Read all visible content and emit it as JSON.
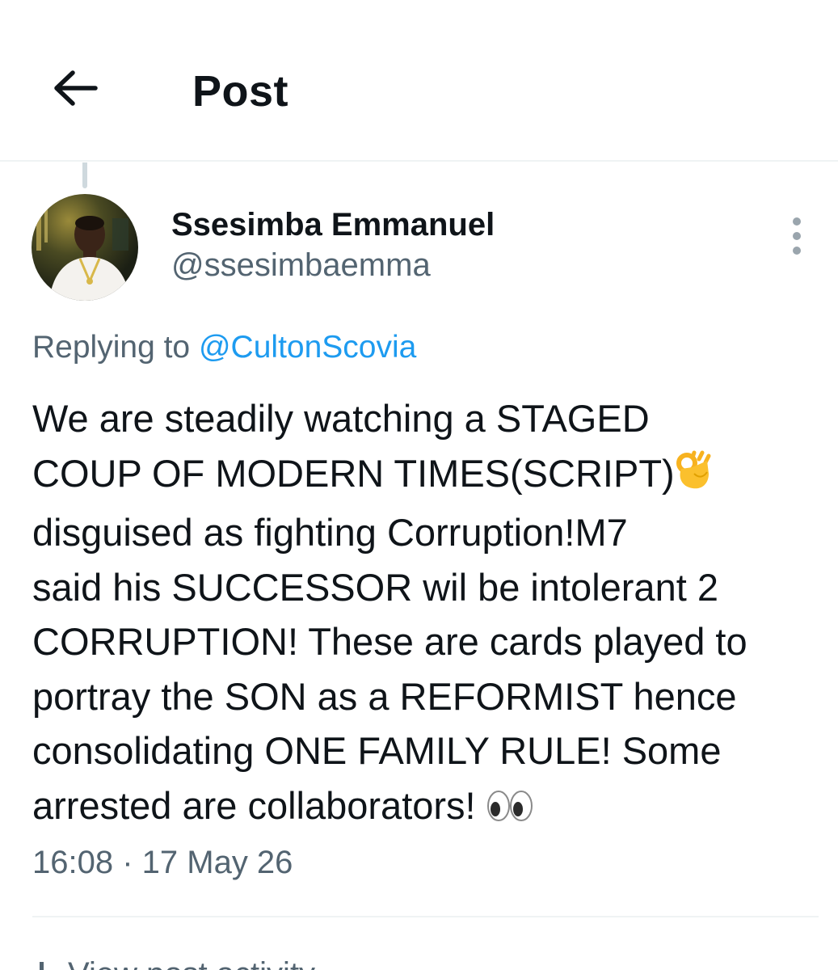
{
  "header": {
    "title": "Post",
    "back_icon": "arrow-left-icon"
  },
  "author": {
    "display_name": "Ssesimba Emmanuel",
    "handle": "@ssesimbaemma",
    "more_icon": "more-vertical-icon"
  },
  "reply": {
    "prefix": "Replying to",
    "mention": "@CultonScovia"
  },
  "post": {
    "lines": [
      "We are steadily watching a STAGED",
      "COUP OF MODERN TIMES(SCRIPT)",
      "disguised as fighting Corruption!M7",
      "said his SUCCESSOR wil be intolerant 2",
      "CORRUPTION! These are cards played to",
      "portray the SON as a REFORMIST hence",
      "consolidating ONE FAMILY RULE! Some",
      "arrested are collaborators!"
    ],
    "emoji_ok_icon": "ok-hand-emoji-icon",
    "emoji_eyes_icon": "eyes-emoji-icon"
  },
  "meta": {
    "timestamp": "16:08 · 17 May 26"
  },
  "activity": {
    "label": "View post activity",
    "icon": "analytics-icon"
  },
  "colors": {
    "text_primary": "#0f1419",
    "text_secondary": "#536471",
    "accent": "#1d9bf0",
    "divider": "#eff3f4"
  }
}
